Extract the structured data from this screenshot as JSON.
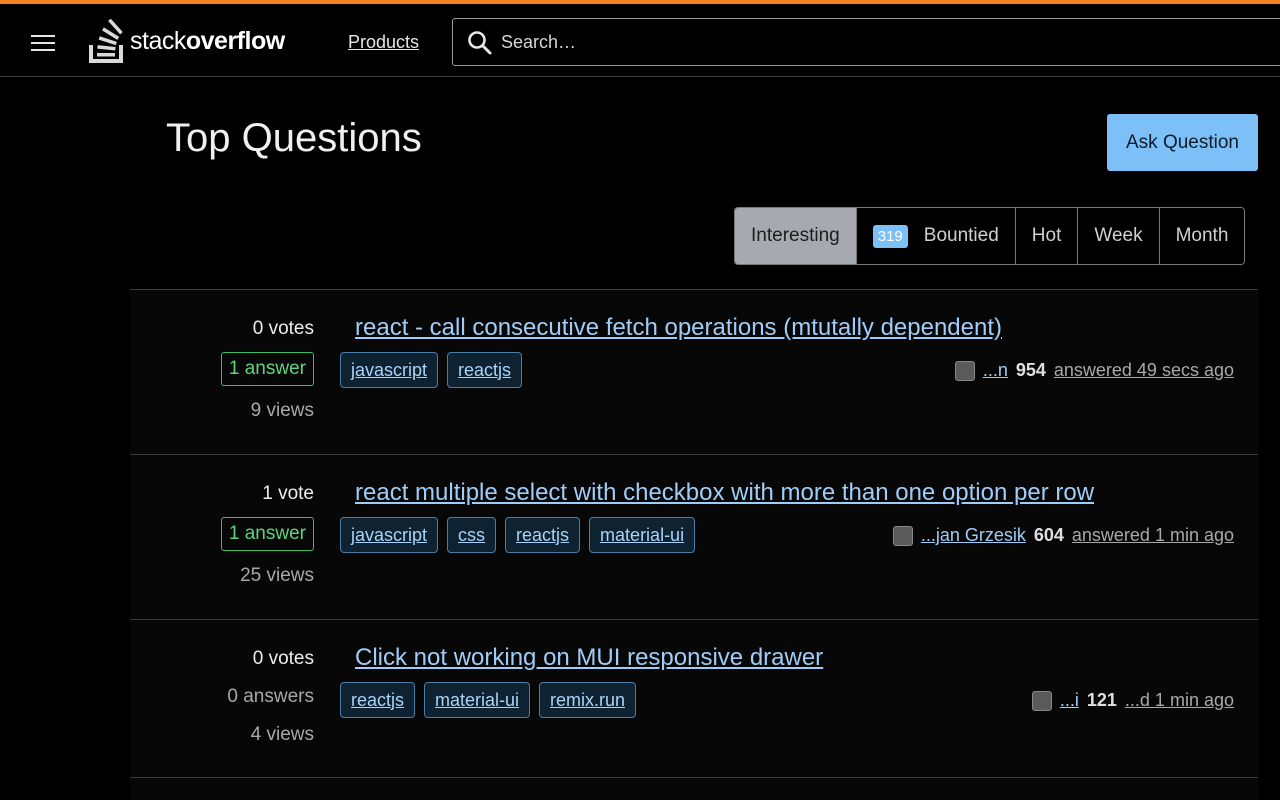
{
  "header": {
    "brand_light": "stack",
    "brand_bold": "overflow",
    "products_label": "Products",
    "search_placeholder": "Search…"
  },
  "main": {
    "title": "Top Questions",
    "ask_button": "Ask Question"
  },
  "filters": [
    {
      "label": "Interesting",
      "active": true
    },
    {
      "label": "Bountied",
      "badge": "319"
    },
    {
      "label": "Hot"
    },
    {
      "label": "Week"
    },
    {
      "label": "Month"
    }
  ],
  "questions": [
    {
      "votes": "0 votes",
      "answers": "1 answer",
      "views": "9 views",
      "title": "react - call consecutive fetch operations (mtutally dependent)",
      "tags": [
        "javascript",
        "reactjs"
      ],
      "user": "...n",
      "rep": "954",
      "action": "answered 49 secs ago"
    },
    {
      "votes": "1 vote",
      "answers": "1 answer",
      "views": "25 views",
      "title": "react multiple select with checkbox with more than one option per row",
      "tags": [
        "javascript",
        "css",
        "reactjs",
        "material-ui"
      ],
      "user": "...jan Grzesik",
      "rep": "604",
      "action": "answered 1 min ago"
    },
    {
      "votes": "0 votes",
      "answers": "0 answers",
      "views": "4 views",
      "title": "Click not working on MUI responsive drawer",
      "tags": [
        "reactjs",
        "material-ui",
        "remix.run"
      ],
      "user": "...i",
      "rep": "121",
      "action": "...d 1 min ago"
    }
  ],
  "colors": {
    "accent": "#f48225",
    "link": "#9fcdf7",
    "primary_button": "#7cc0f7",
    "answered_green": "#5dd47d"
  }
}
